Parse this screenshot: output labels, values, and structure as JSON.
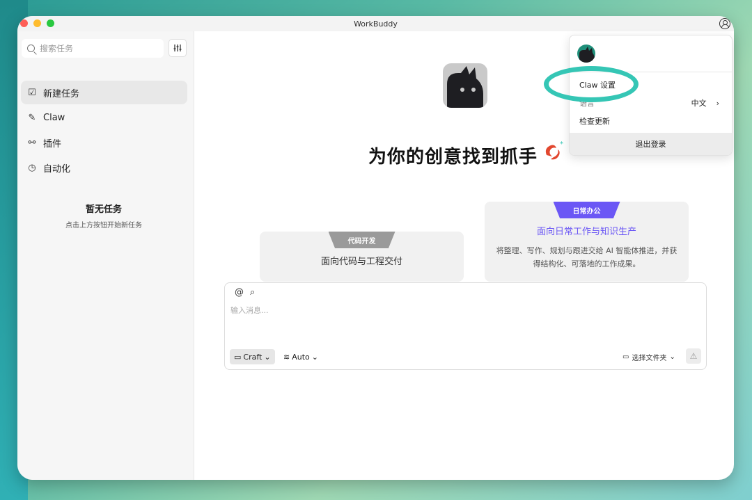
{
  "window": {
    "title": "WorkBuddy"
  },
  "sidebar": {
    "search_placeholder": "搜索任务",
    "filter_icon": "sliders-icon",
    "items": [
      {
        "label": "新建任务",
        "icon": "checkbox-icon",
        "active": true
      },
      {
        "label": "Claw",
        "icon": "claw-icon",
        "active": false
      },
      {
        "label": "插件",
        "icon": "plug-icon",
        "active": false
      },
      {
        "label": "自动化",
        "icon": "clock-icon",
        "active": false
      }
    ],
    "empty_title": "暂无任务",
    "empty_subtitle": "点击上方按钮开始新任务"
  },
  "main": {
    "headline": "为你的创意找到抓手",
    "cards": [
      {
        "badge": "代码开发",
        "title": "面向代码与工程交付",
        "color": "#9a9a9a"
      },
      {
        "badge": "日常办公",
        "title": "面向日常工作与知识生产",
        "description": "将整理、写作、规划与跟进交给 AI 智能体推进，并获得结构化、可落地的工作成果。",
        "color": "#6b57f5"
      }
    ],
    "composer": {
      "placeholder": "输入消息...",
      "mode_label": "Craft",
      "model_label": "Auto",
      "folder_label": "选择文件夹"
    }
  },
  "dropdown": {
    "items": [
      {
        "label": "Claw 设置"
      },
      {
        "label": "语言",
        "value": "中文"
      },
      {
        "label": "检查更新"
      }
    ],
    "logout_label": "退出登录"
  },
  "colors": {
    "accent": "#6b57f5",
    "highlight": "#35c6b5"
  }
}
